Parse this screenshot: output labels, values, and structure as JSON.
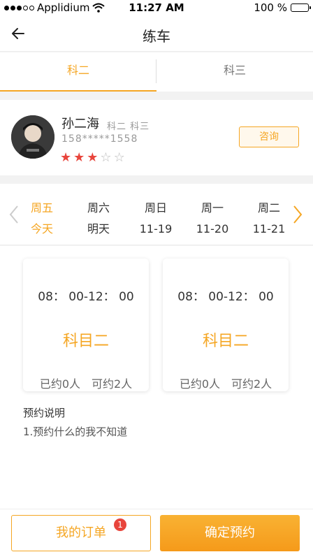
{
  "status_bar": {
    "carrier": "Applidium",
    "time": "11:27 AM",
    "battery": "100 %"
  },
  "nav": {
    "title": "练车",
    "back_icon": "arrow-left-icon"
  },
  "tabs": [
    {
      "label": "科二",
      "active": true
    },
    {
      "label": "科三",
      "active": false
    }
  ],
  "coach": {
    "name": "孙二海",
    "subjects": "科二 科三",
    "phone": "158*****1558",
    "rating": 3,
    "rating_max": 5,
    "consult_label": "咨询"
  },
  "week": {
    "days": [
      {
        "weekday": "周五",
        "date": "今天",
        "active": true
      },
      {
        "weekday": "周六",
        "date": "明天",
        "active": false
      },
      {
        "weekday": "周日",
        "date": "11-19",
        "active": false
      },
      {
        "weekday": "周一",
        "date": "11-20",
        "active": false
      },
      {
        "weekday": "周二",
        "date": "11-21",
        "active": false
      }
    ]
  },
  "slots": [
    {
      "time": "08： 00-12： 00",
      "subject": "科目二",
      "count": "已约0人　可约2人"
    },
    {
      "time": "08： 00-12： 00",
      "subject": "科目二",
      "count": "已约0人　可约2人"
    }
  ],
  "notes": {
    "title": "预约说明",
    "body": "1.预约什么的我不知道"
  },
  "footer": {
    "orders_label": "我的订单",
    "orders_badge": "1",
    "confirm_label": "确定预约"
  },
  "colors": {
    "accent": "#f5a623",
    "star": "#e8453c",
    "badge": "#e8453c"
  }
}
